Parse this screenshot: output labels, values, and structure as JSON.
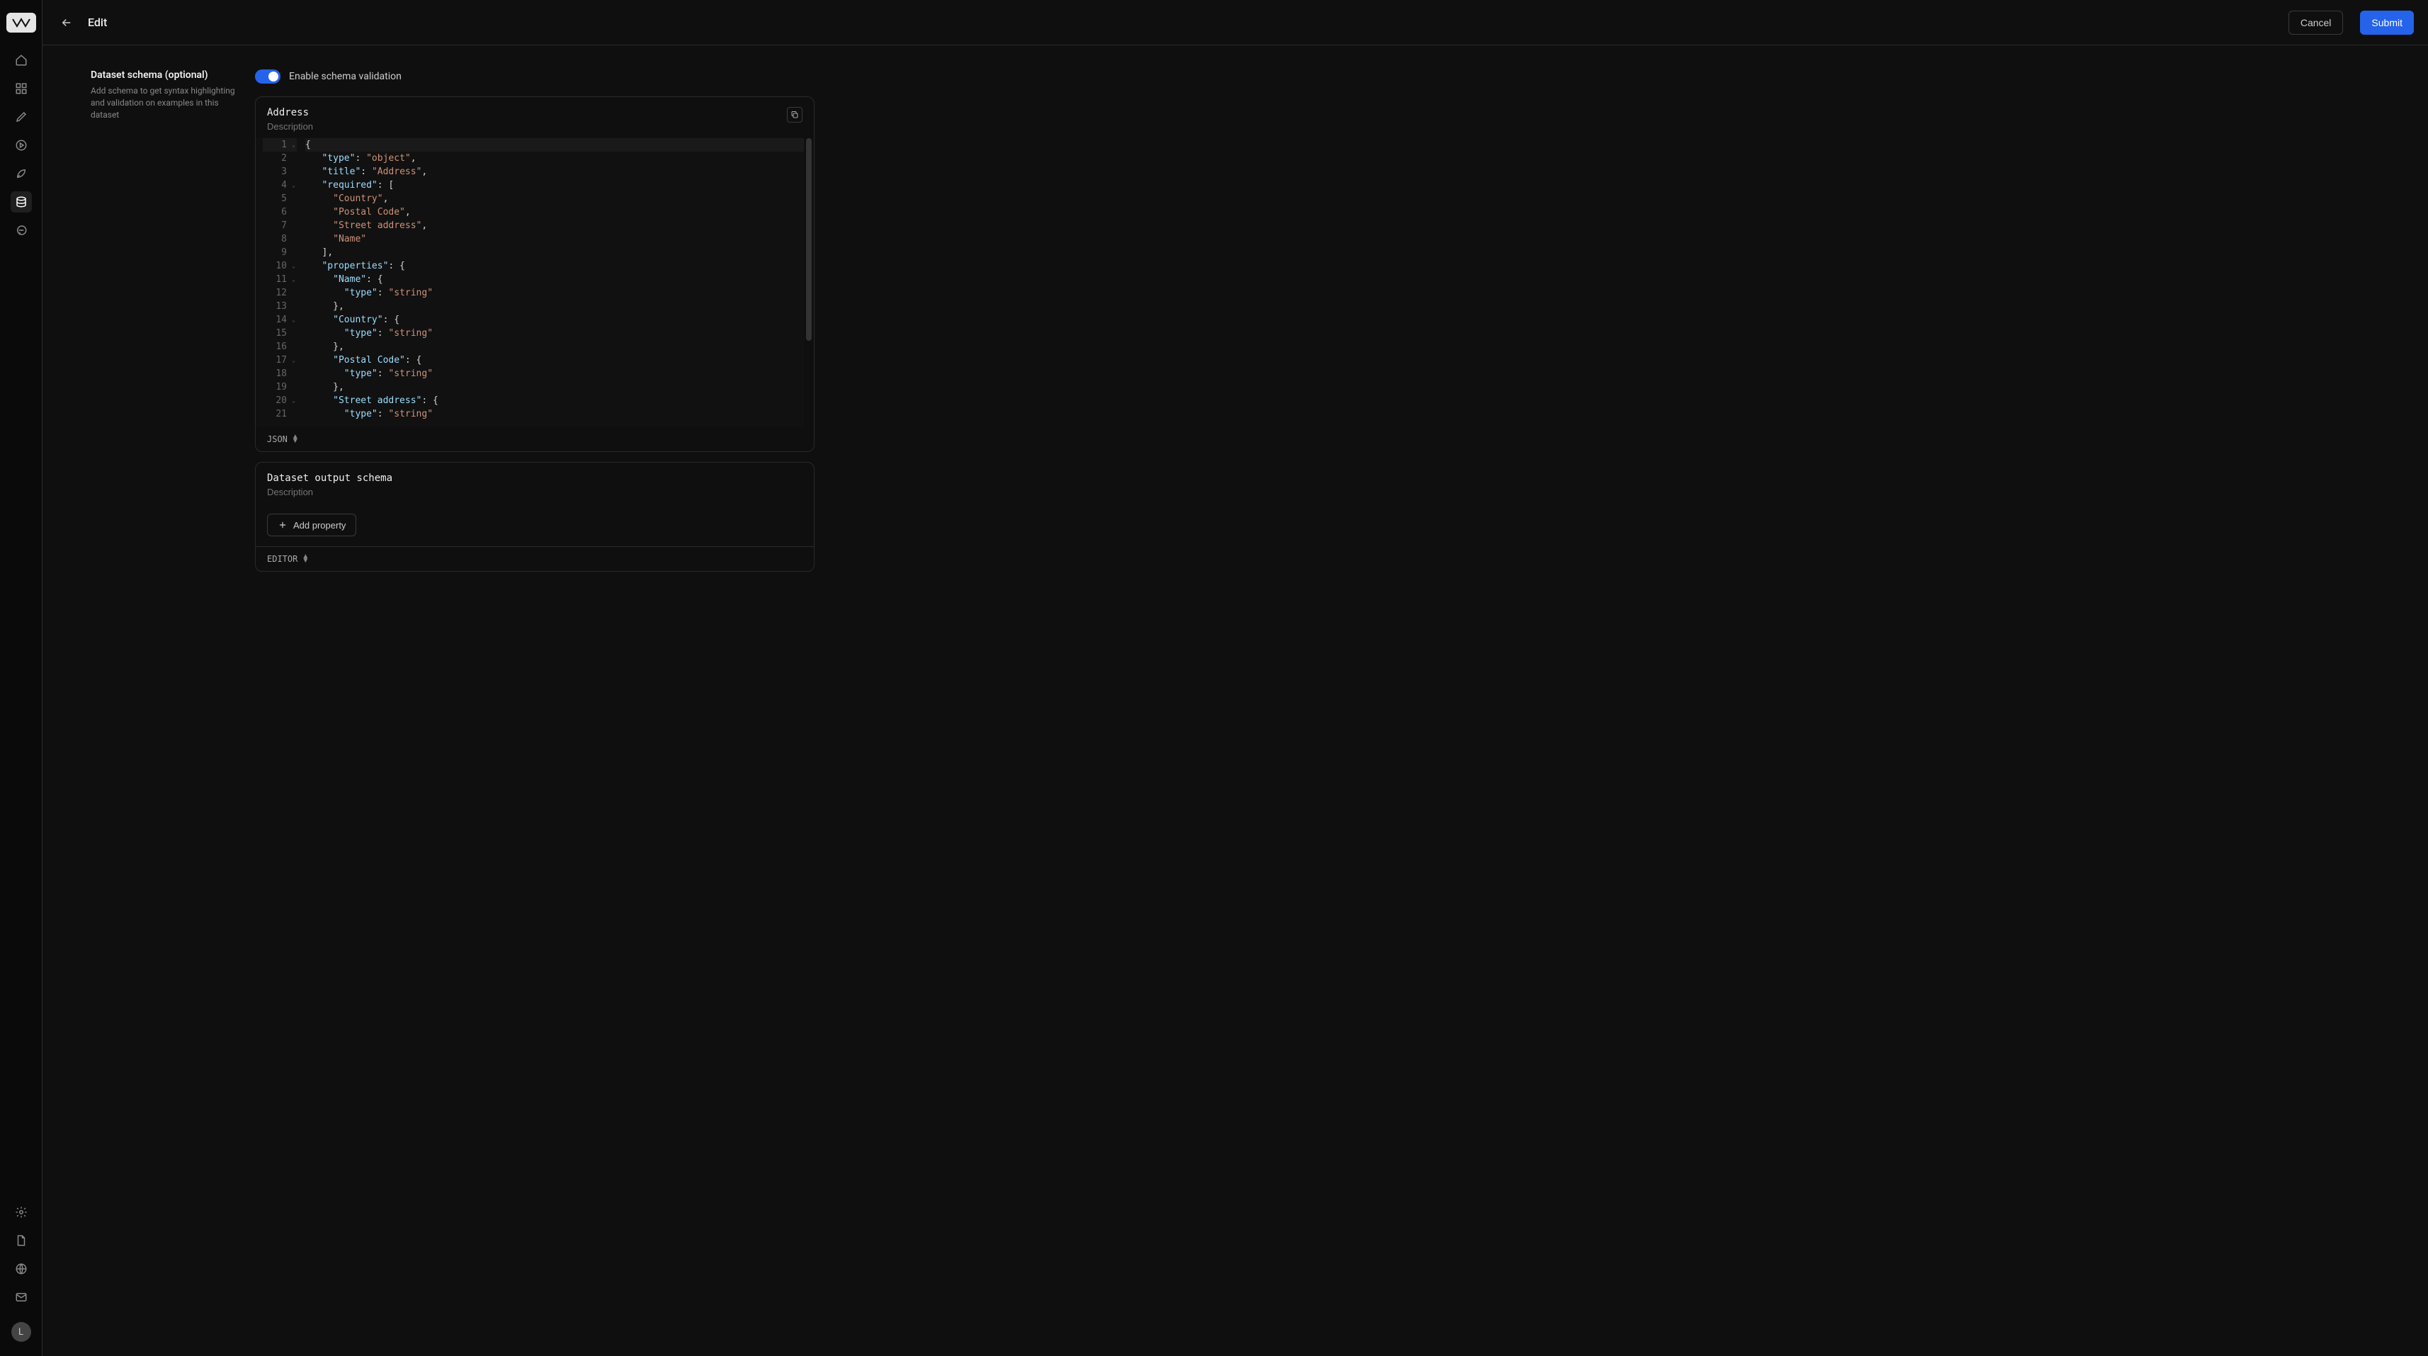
{
  "topbar": {
    "page_title": "Edit",
    "cancel_label": "Cancel",
    "submit_label": "Submit"
  },
  "sidebar": {
    "avatar_initial": "L"
  },
  "left_panel": {
    "heading": "Dataset schema (optional)",
    "description": "Add schema to get syntax highlighting and validation on examples in this dataset"
  },
  "toggle": {
    "label": "Enable schema validation",
    "on": true
  },
  "schema_input": {
    "title_value": "Address",
    "description_placeholder": "Description",
    "footer_label": "JSON",
    "code_lines": [
      {
        "n": 1,
        "fold": true,
        "tokens": [
          [
            "punc",
            "{"
          ]
        ]
      },
      {
        "n": 2,
        "fold": false,
        "tokens": [
          [
            "pad",
            "   "
          ],
          [
            "key",
            "\"type\""
          ],
          [
            "punc",
            ": "
          ],
          [
            "str",
            "\"object\""
          ],
          [
            "punc",
            ","
          ]
        ]
      },
      {
        "n": 3,
        "fold": false,
        "tokens": [
          [
            "pad",
            "   "
          ],
          [
            "key",
            "\"title\""
          ],
          [
            "punc",
            ": "
          ],
          [
            "str",
            "\"Address\""
          ],
          [
            "punc",
            ","
          ]
        ]
      },
      {
        "n": 4,
        "fold": true,
        "tokens": [
          [
            "pad",
            "   "
          ],
          [
            "key",
            "\"required\""
          ],
          [
            "punc",
            ": ["
          ]
        ]
      },
      {
        "n": 5,
        "fold": false,
        "tokens": [
          [
            "pad",
            "     "
          ],
          [
            "str",
            "\"Country\""
          ],
          [
            "punc",
            ","
          ]
        ]
      },
      {
        "n": 6,
        "fold": false,
        "tokens": [
          [
            "pad",
            "     "
          ],
          [
            "str",
            "\"Postal Code\""
          ],
          [
            "punc",
            ","
          ]
        ]
      },
      {
        "n": 7,
        "fold": false,
        "tokens": [
          [
            "pad",
            "     "
          ],
          [
            "str",
            "\"Street address\""
          ],
          [
            "punc",
            ","
          ]
        ]
      },
      {
        "n": 8,
        "fold": false,
        "tokens": [
          [
            "pad",
            "     "
          ],
          [
            "str",
            "\"Name\""
          ]
        ]
      },
      {
        "n": 9,
        "fold": false,
        "tokens": [
          [
            "pad",
            "   "
          ],
          [
            "punc",
            "],"
          ]
        ]
      },
      {
        "n": 10,
        "fold": true,
        "tokens": [
          [
            "pad",
            "   "
          ],
          [
            "key",
            "\"properties\""
          ],
          [
            "punc",
            ": {"
          ]
        ]
      },
      {
        "n": 11,
        "fold": true,
        "tokens": [
          [
            "pad",
            "     "
          ],
          [
            "key",
            "\"Name\""
          ],
          [
            "punc",
            ": {"
          ]
        ]
      },
      {
        "n": 12,
        "fold": false,
        "tokens": [
          [
            "pad",
            "       "
          ],
          [
            "key",
            "\"type\""
          ],
          [
            "punc",
            ": "
          ],
          [
            "str",
            "\"string\""
          ]
        ]
      },
      {
        "n": 13,
        "fold": false,
        "tokens": [
          [
            "pad",
            "     "
          ],
          [
            "punc",
            "},"
          ]
        ]
      },
      {
        "n": 14,
        "fold": true,
        "tokens": [
          [
            "pad",
            "     "
          ],
          [
            "key",
            "\"Country\""
          ],
          [
            "punc",
            ": {"
          ]
        ]
      },
      {
        "n": 15,
        "fold": false,
        "tokens": [
          [
            "pad",
            "       "
          ],
          [
            "key",
            "\"type\""
          ],
          [
            "punc",
            ": "
          ],
          [
            "str",
            "\"string\""
          ]
        ]
      },
      {
        "n": 16,
        "fold": false,
        "tokens": [
          [
            "pad",
            "     "
          ],
          [
            "punc",
            "},"
          ]
        ]
      },
      {
        "n": 17,
        "fold": true,
        "tokens": [
          [
            "pad",
            "     "
          ],
          [
            "key",
            "\"Postal Code\""
          ],
          [
            "punc",
            ": {"
          ]
        ]
      },
      {
        "n": 18,
        "fold": false,
        "tokens": [
          [
            "pad",
            "       "
          ],
          [
            "key",
            "\"type\""
          ],
          [
            "punc",
            ": "
          ],
          [
            "str",
            "\"string\""
          ]
        ]
      },
      {
        "n": 19,
        "fold": false,
        "tokens": [
          [
            "pad",
            "     "
          ],
          [
            "punc",
            "},"
          ]
        ]
      },
      {
        "n": 20,
        "fold": true,
        "tokens": [
          [
            "pad",
            "     "
          ],
          [
            "key",
            "\"Street address\""
          ],
          [
            "punc",
            ": {"
          ]
        ]
      },
      {
        "n": 21,
        "fold": false,
        "tokens": [
          [
            "pad",
            "       "
          ],
          [
            "key",
            "\"type\""
          ],
          [
            "punc",
            ": "
          ],
          [
            "str",
            "\"string\""
          ]
        ]
      }
    ],
    "current_line": 1
  },
  "schema_output": {
    "title_value": "Dataset output schema",
    "description_placeholder": "Description",
    "add_property_label": "Add property",
    "footer_label": "EDITOR"
  },
  "colors": {
    "accent": "#2563eb"
  }
}
